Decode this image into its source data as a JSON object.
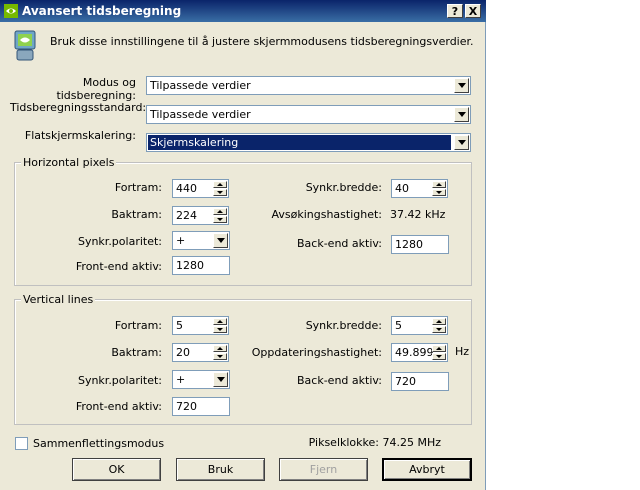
{
  "window": {
    "title": "Avansert tidsberegning",
    "help_button": "?",
    "close_button": "X"
  },
  "intro_text": "Bruk disse innstillingene til å justere skjermmodusens tidsberegningsverdier.",
  "settings": {
    "mode_label_line1": "Modus og",
    "mode_label_line2": "tidsberegning:",
    "mode_value": "Tilpassede verdier",
    "standard_label": "Tidsberegningsstandard:",
    "standard_value": "Tilpassede verdier",
    "flat_label": "Flatskjermskalering:",
    "flat_value": "Skjermskalering"
  },
  "horizontal": {
    "title": "Horizontal pixels",
    "fortram_label": "Fortram:",
    "fortram_value": "440",
    "baktram_label": "Baktram:",
    "baktram_value": "224",
    "polarity_label": "Synkr.polaritet:",
    "polarity_value": "+",
    "frontend_label": "Front-end aktiv:",
    "frontend_value": "1280",
    "sync_width_label": "Synkr.bredde:",
    "sync_width_value": "40",
    "scan_label": "Avsøkingshastighet:",
    "scan_value": "37.42 kHz",
    "backend_label": "Back-end aktiv:",
    "backend_value": "1280"
  },
  "vertical": {
    "title": "Vertical lines",
    "fortram_label": "Fortram:",
    "fortram_value": "5",
    "baktram_label": "Baktram:",
    "baktram_value": "20",
    "polarity_label": "Synkr.polaritet:",
    "polarity_value": "+",
    "frontend_label": "Front-end aktiv:",
    "frontend_value": "720",
    "sync_width_label": "Synkr.bredde:",
    "sync_width_value": "5",
    "refresh_label": "Oppdateringshastighet:",
    "refresh_value": "49.899",
    "refresh_unit": "Hz",
    "backend_label": "Back-end aktiv:",
    "backend_value": "720"
  },
  "interlace_label": "Sammenflettingsmodus",
  "pixel_clock": "Pikselklokke:  74.25 MHz",
  "buttons": {
    "ok": "OK",
    "apply": "Bruk",
    "remove": "Fjern",
    "cancel": "Avbryt"
  }
}
